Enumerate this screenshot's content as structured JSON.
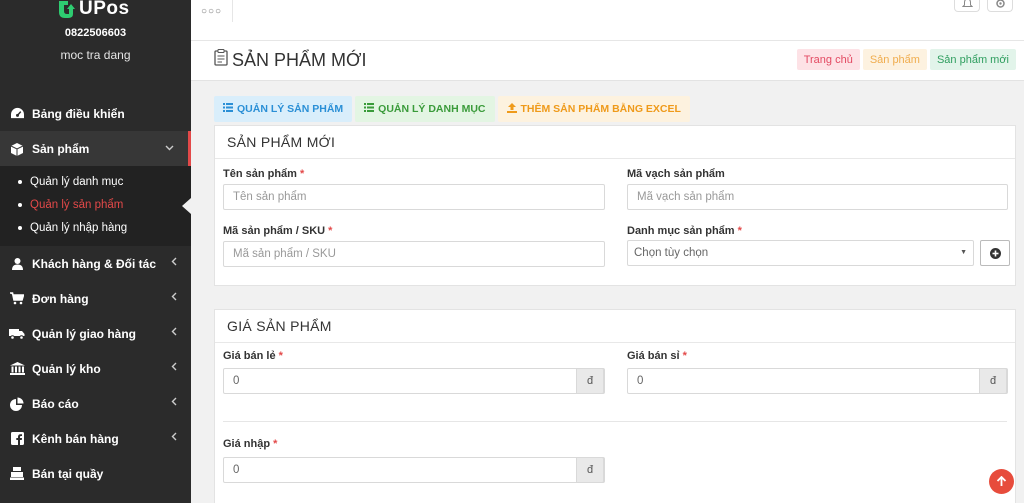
{
  "app": {
    "logo_text": "UPos",
    "phone": "0822506603",
    "username": "moc tra dang"
  },
  "sidebar": {
    "items": [
      {
        "label": "Bảng điều khiển",
        "icon": "dashboard-icon"
      },
      {
        "label": "Sản phẩm",
        "icon": "box-icon"
      },
      {
        "label": "Khách hàng & Đối tác",
        "icon": "user-icon"
      },
      {
        "label": "Đơn hàng",
        "icon": "cart-icon"
      },
      {
        "label": "Quản lý giao hàng",
        "icon": "truck-icon"
      },
      {
        "label": "Quản lý kho",
        "icon": "warehouse-icon"
      },
      {
        "label": "Báo cáo",
        "icon": "pie-chart-icon"
      },
      {
        "label": "Kênh bán hàng",
        "icon": "facebook-icon"
      },
      {
        "label": "Bán tại quầy",
        "icon": "cash-register-icon"
      }
    ],
    "submenu": [
      {
        "label": "Quản lý danh mục"
      },
      {
        "label": "Quản lý sản phẩm"
      },
      {
        "label": "Quản lý nhập hàng"
      }
    ]
  },
  "header": {
    "title": "SẢN PHẨM MỚI",
    "breadcrumbs": [
      "Trang chủ",
      "Sản phẩm",
      "Sản phẩm mới"
    ]
  },
  "tabs": [
    {
      "label": "QUẢN LÝ SẢN PHẨM"
    },
    {
      "label": "QUẢN LÝ DANH MỤC"
    },
    {
      "label": "THÊM SẢN PHẨM BẰNG EXCEL"
    }
  ],
  "product_panel": {
    "title": "SẢN PHẨM MỚI",
    "name_label": "Tên sản phẩm",
    "name_placeholder": "Tên sản phẩm",
    "barcode_label": "Mã vạch sản phẩm",
    "barcode_placeholder": "Mã vạch sản phẩm",
    "sku_label": "Mã sản phẩm / SKU",
    "sku_placeholder": "Mã sản phẩm / SKU",
    "category_label": "Danh mục sản phẩm",
    "category_value": "Chọn tùy chọn"
  },
  "price_panel": {
    "title": "GIÁ SẢN PHẨM",
    "retail_label": "Giá bán lẻ",
    "retail_value": "0",
    "wholesale_label": "Giá bán sỉ",
    "wholesale_value": "0",
    "import_label": "Giá nhập",
    "import_value": "0",
    "currency": "đ"
  },
  "required_mark": "*",
  "colors": {
    "sidebar_bg": "#2b2b2b",
    "accent_red": "#e34949",
    "logo_green": "#2ecc71"
  }
}
